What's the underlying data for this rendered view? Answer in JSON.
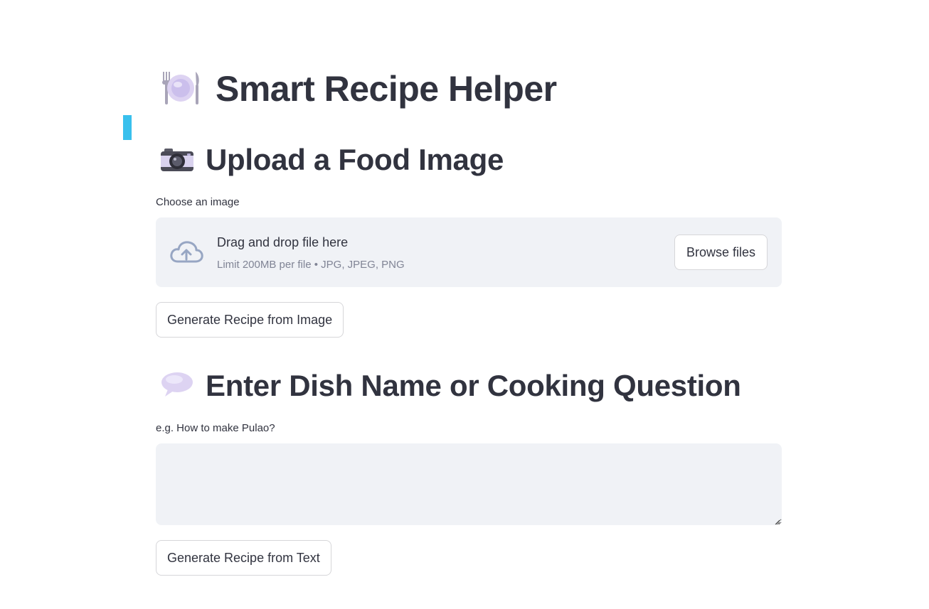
{
  "colors": {
    "accent_bar": "#39c0ed",
    "text": "#31333f",
    "muted": "#808495",
    "surface": "#f0f2f6",
    "border": "#d6d6d9"
  },
  "header": {
    "icon": "plate-with-cutlery-icon",
    "title": "Smart Recipe Helper"
  },
  "upload_section": {
    "icon": "camera-icon",
    "heading": "Upload a Food Image",
    "label": "Choose an image",
    "dropzone": {
      "icon": "cloud-upload-icon",
      "title": "Drag and drop file here",
      "subtitle": "Limit 200MB per file • JPG, JPEG, PNG",
      "browse_label": "Browse files"
    },
    "generate_label": "Generate Recipe from Image"
  },
  "text_section": {
    "icon": "speech-bubble-icon",
    "heading": "Enter Dish Name or Cooking Question",
    "label": "e.g. How to make Pulao?",
    "input_value": "",
    "generate_label": "Generate Recipe from Text"
  }
}
